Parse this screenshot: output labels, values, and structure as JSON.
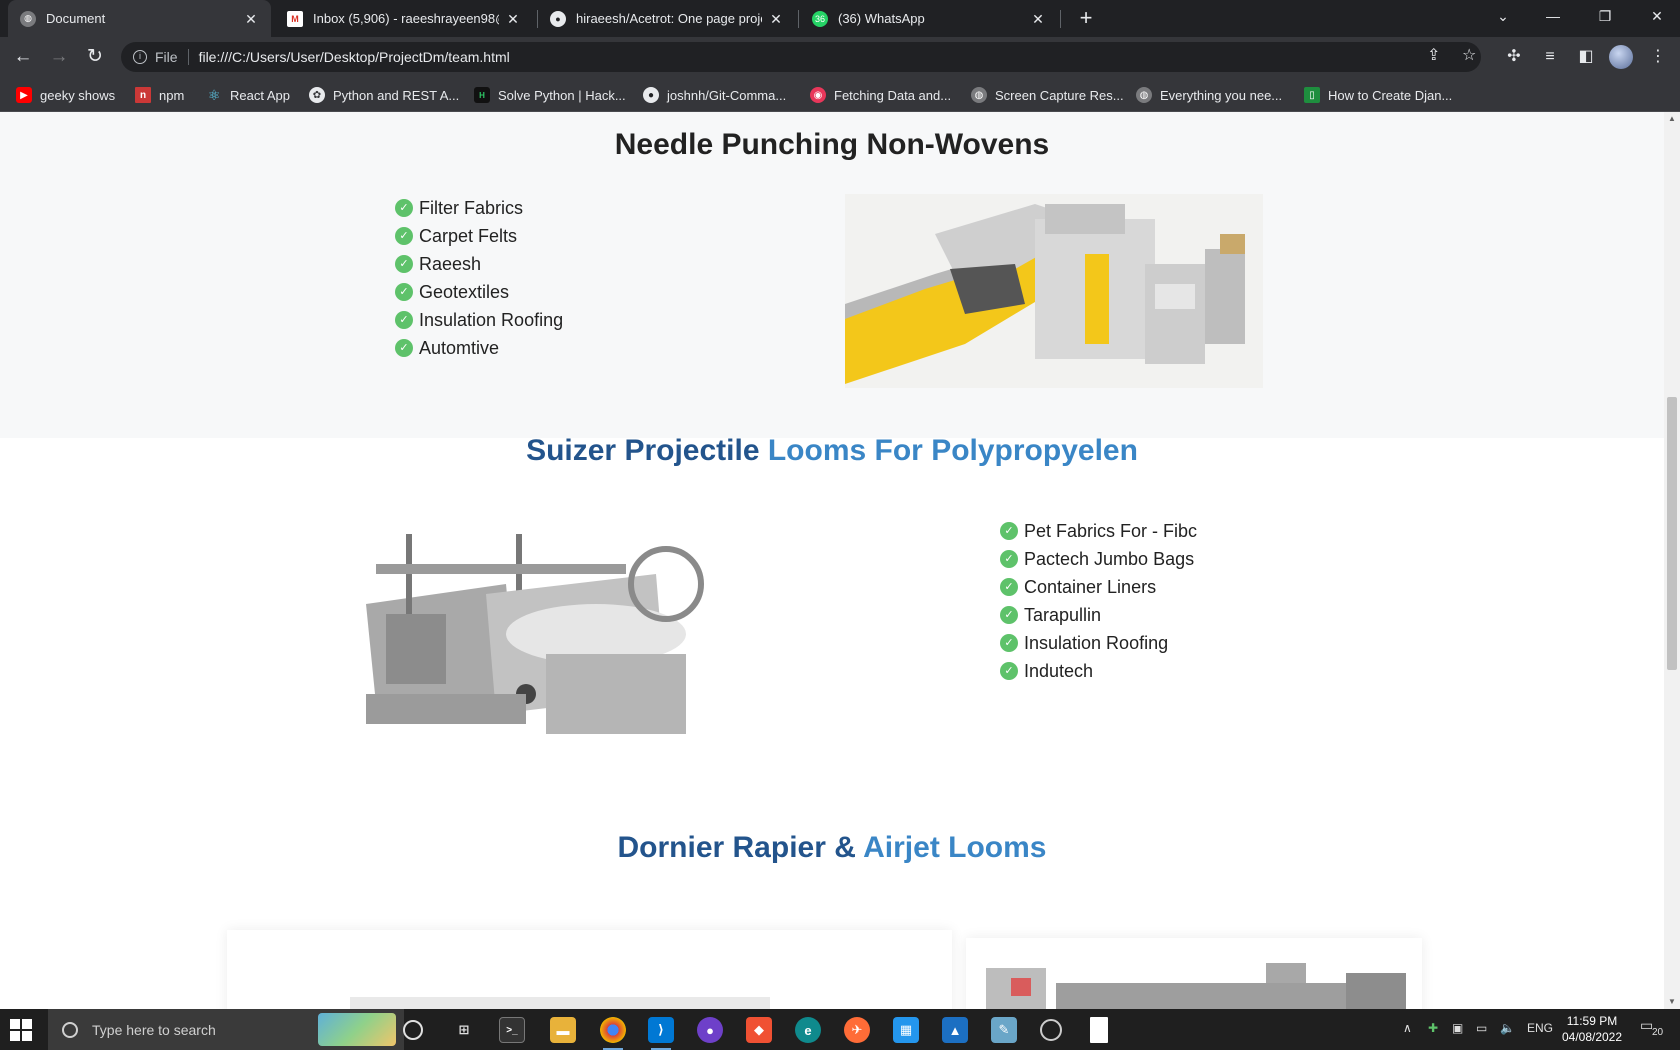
{
  "browser": {
    "tabs": [
      {
        "title": "Document",
        "active": true
      },
      {
        "title": "Inbox (5,906) - raeeshrayeen98@",
        "active": false
      },
      {
        "title": "hiraeesh/Acetrot: One page proje",
        "active": false
      },
      {
        "title": "(36) WhatsApp",
        "active": false
      }
    ],
    "whatsapp_badge": "36",
    "address": {
      "scheme": "File",
      "url": "file:///C:/Users/User/Desktop/ProjectDm/team.html"
    },
    "bookmarks": [
      {
        "label": "geeky shows",
        "icon": "youtube-icon"
      },
      {
        "label": "npm",
        "icon": "npm-icon"
      },
      {
        "label": "React App",
        "icon": "react-icon"
      },
      {
        "label": "Python and REST A...",
        "icon": "python-icon"
      },
      {
        "label": "Solve Python | Hack...",
        "icon": "hackerrank-icon"
      },
      {
        "label": "joshnh/Git-Comma...",
        "icon": "github-icon"
      },
      {
        "label": "Fetching Data and...",
        "icon": "scrimba-icon"
      },
      {
        "label": "Screen Capture Res...",
        "icon": "globe-icon"
      },
      {
        "label": "Everything you nee...",
        "icon": "globe-icon"
      },
      {
        "label": "How to Create Djan...",
        "icon": "bookmark-icon"
      }
    ]
  },
  "page": {
    "section1": {
      "title": "Needle Punching Non-Wovens",
      "features": [
        "Filter Fabrics",
        "Carpet Felts",
        "Raeesh",
        "Geotextiles",
        "Insulation Roofing",
        "Automtive"
      ]
    },
    "section2": {
      "title_part1": "Suizer Projectile",
      "title_part2": "Looms For Polypropyelen",
      "features": [
        "Pet Fabrics For - Fibc",
        "Pactech Jumbo Bags",
        "Container Liners",
        "Tarapullin",
        "Insulation Roofing",
        "Indutech"
      ]
    },
    "section3": {
      "title_part1": "Dornier Rapier &",
      "title_part2": "Airjet Looms"
    }
  },
  "taskbar": {
    "search_placeholder": "Type here to search",
    "language": "ENG",
    "time": "11:59 PM",
    "date": "04/08/2022",
    "notifications": "20"
  },
  "colors": {
    "heading_dark_blue": "#23548c",
    "heading_light_blue": "#3a86c6",
    "check_green": "#5ec26a",
    "section_bg": "#f7f8f9"
  }
}
